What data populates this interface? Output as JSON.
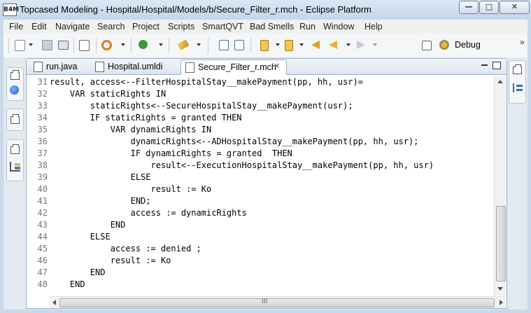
{
  "window": {
    "title": "Topcased Modeling - Hospital/Hospital/Models/b/Secure_Filter_r.mch - Eclipse Platform",
    "app_icon": "B4M",
    "controls": {
      "minimize": "—",
      "maximize": "□",
      "close": "✕"
    }
  },
  "menu": [
    "File",
    "Edit",
    "Navigate",
    "Search",
    "Project",
    "Scripts",
    "SmartQVT",
    "Bad Smells",
    "Run",
    "Window",
    "Help"
  ],
  "toolbar": {
    "perspective_label": "Debug",
    "overflow": "»",
    "icons": [
      "new-wizard-icon",
      "save-icon",
      "print-icon",
      "binary-icon",
      "search-icon",
      "run-icon",
      "marker-icon",
      "toggle-view-icon",
      "paragraph-icon",
      "next-annotation-icon",
      "previous-annotation-icon",
      "last-edit-icon",
      "back-icon",
      "forward-icon",
      "open-perspective-icon",
      "debug-icon"
    ]
  },
  "editor": {
    "tabs": [
      {
        "label": "run.java",
        "icon": "java-file-icon",
        "active": false
      },
      {
        "label": "Hospital.umldi",
        "icon": "uml-diagram-icon",
        "active": false
      },
      {
        "label": "Secure_Filter_r.mch",
        "icon": "text-file-icon",
        "active": true,
        "close": "✕"
      }
    ],
    "lines": [
      {
        "n": "31",
        "text": "result, access<--FilterHospitalStay__makePayment(pp, hh, usr)="
      },
      {
        "n": "32",
        "text": "    VAR staticRights IN"
      },
      {
        "n": "33",
        "text": "        staticRights<--SecureHospitalStay__makePayment(usr);"
      },
      {
        "n": "34",
        "text": "        IF staticRights = granted THEN"
      },
      {
        "n": "35",
        "text": "            VAR dynamicRights IN"
      },
      {
        "n": "36",
        "text": "                dynamicRights<--ADHospitalStay__makePayment(pp, hh, usr);"
      },
      {
        "n": "37",
        "text": "                IF dynamicRights = granted  THEN"
      },
      {
        "n": "38",
        "text": "                    result<--ExecutionHospitalStay__makePayment(pp, hh, usr)"
      },
      {
        "n": "39",
        "text": "                ELSE"
      },
      {
        "n": "40",
        "text": "                    result := Ko"
      },
      {
        "n": "41",
        "text": "                END;"
      },
      {
        "n": "42",
        "text": "                access := dynamicRights"
      },
      {
        "n": "43",
        "text": "            END"
      },
      {
        "n": "44",
        "text": "        ELSE"
      },
      {
        "n": "45",
        "text": "            access := denied ;"
      },
      {
        "n": "46",
        "text": "            result := Ko"
      },
      {
        "n": "47",
        "text": "        END"
      },
      {
        "n": "48",
        "text": "    END"
      }
    ],
    "hscroll_grip": "III"
  }
}
